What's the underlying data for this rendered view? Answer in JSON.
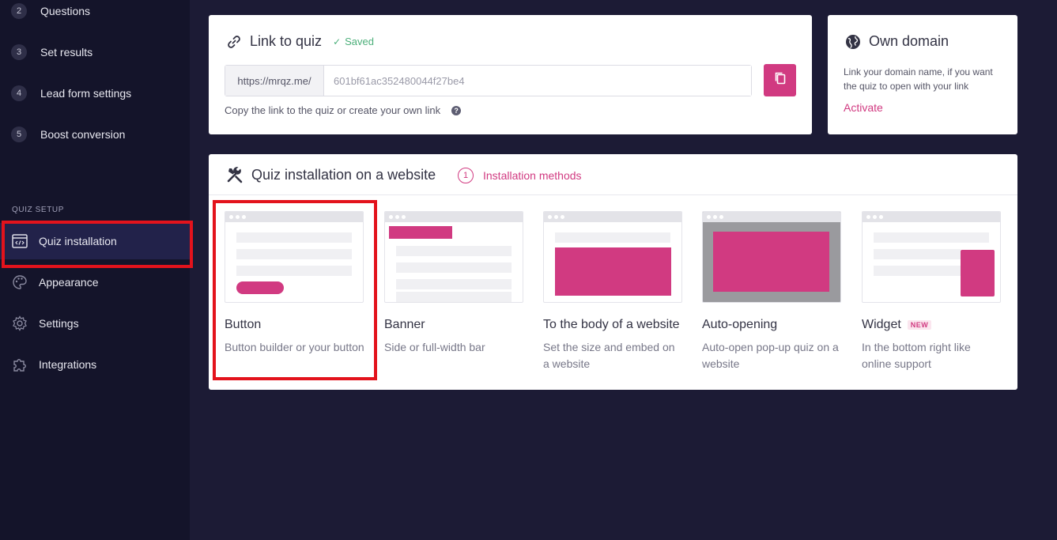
{
  "sidebar": {
    "steps": [
      {
        "num": "2",
        "label": "Questions"
      },
      {
        "num": "3",
        "label": "Set results"
      },
      {
        "num": "4",
        "label": "Lead form settings"
      },
      {
        "num": "5",
        "label": "Boost conversion"
      }
    ],
    "section_label": "QUIZ SETUP",
    "items": [
      {
        "label": "Quiz installation",
        "icon": "code-window-icon"
      },
      {
        "label": "Appearance",
        "icon": "palette-icon"
      },
      {
        "label": "Settings",
        "icon": "gear-icon"
      },
      {
        "label": "Integrations",
        "icon": "puzzle-icon"
      }
    ]
  },
  "link_card": {
    "title": "Link to quiz",
    "saved_label": "Saved",
    "url_prefix": "https://mrqz.me/",
    "url_value": "601bf61ac352480044f27be4",
    "hint": "Copy the link to the quiz or create your own link",
    "help_glyph": "?"
  },
  "domain_card": {
    "title": "Own domain",
    "text": "Link your domain name, if you want the quiz to open with your link",
    "activate_label": "Activate"
  },
  "install_card": {
    "title": "Quiz installation on a website",
    "methods_num": "1",
    "methods_label": "Installation methods",
    "methods": [
      {
        "title": "Button",
        "desc": "Button builder or your button",
        "badge": ""
      },
      {
        "title": "Banner",
        "desc": "Side or full-width bar",
        "badge": ""
      },
      {
        "title": "To the body of a website",
        "desc": "Set the size and embed on a website",
        "badge": ""
      },
      {
        "title": "Auto-opening",
        "desc": "Auto-open pop-up quiz on a website",
        "badge": ""
      },
      {
        "title": "Widget",
        "desc": "In the bottom right like online support",
        "badge": "NEW"
      }
    ]
  },
  "colors": {
    "accent": "#d13a81",
    "sidebar_bg": "#14142a",
    "page_bg": "#1c1b35",
    "highlight": "#e3131c",
    "saved": "#4caf7a"
  }
}
